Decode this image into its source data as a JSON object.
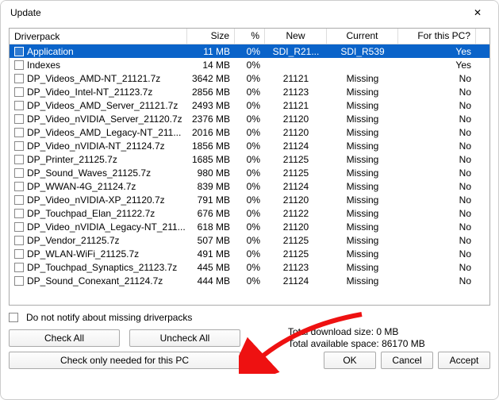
{
  "window": {
    "title": "Update",
    "close_glyph": "✕"
  },
  "columns": {
    "driverpack": "Driverpack",
    "size": "Size",
    "percent": "%",
    "new": "New",
    "current": "Current",
    "forpc": "For this PC?"
  },
  "rows": [
    {
      "name": "Application",
      "size": "11 MB",
      "pct": "0%",
      "new": "SDI_R21...",
      "cur": "SDI_R539",
      "forpc": "Yes",
      "selected": true
    },
    {
      "name": "Indexes",
      "size": "14 MB",
      "pct": "0%",
      "new": "",
      "cur": "",
      "forpc": "Yes"
    },
    {
      "name": "DP_Videos_AMD-NT_21121.7z",
      "size": "3642 MB",
      "pct": "0%",
      "new": "21121",
      "cur": "Missing",
      "forpc": "No"
    },
    {
      "name": "DP_Video_Intel-NT_21123.7z",
      "size": "2856 MB",
      "pct": "0%",
      "new": "21123",
      "cur": "Missing",
      "forpc": "No"
    },
    {
      "name": "DP_Videos_AMD_Server_21121.7z",
      "size": "2493 MB",
      "pct": "0%",
      "new": "21121",
      "cur": "Missing",
      "forpc": "No"
    },
    {
      "name": "DP_Video_nVIDIA_Server_21120.7z",
      "size": "2376 MB",
      "pct": "0%",
      "new": "21120",
      "cur": "Missing",
      "forpc": "No"
    },
    {
      "name": "DP_Videos_AMD_Legacy-NT_211...",
      "size": "2016 MB",
      "pct": "0%",
      "new": "21120",
      "cur": "Missing",
      "forpc": "No"
    },
    {
      "name": "DP_Video_nVIDIA-NT_21124.7z",
      "size": "1856 MB",
      "pct": "0%",
      "new": "21124",
      "cur": "Missing",
      "forpc": "No"
    },
    {
      "name": "DP_Printer_21125.7z",
      "size": "1685 MB",
      "pct": "0%",
      "new": "21125",
      "cur": "Missing",
      "forpc": "No"
    },
    {
      "name": "DP_Sound_Waves_21125.7z",
      "size": "980 MB",
      "pct": "0%",
      "new": "21125",
      "cur": "Missing",
      "forpc": "No"
    },
    {
      "name": "DP_WWAN-4G_21124.7z",
      "size": "839 MB",
      "pct": "0%",
      "new": "21124",
      "cur": "Missing",
      "forpc": "No"
    },
    {
      "name": "DP_Video_nVIDIA-XP_21120.7z",
      "size": "791 MB",
      "pct": "0%",
      "new": "21120",
      "cur": "Missing",
      "forpc": "No"
    },
    {
      "name": "DP_Touchpad_Elan_21122.7z",
      "size": "676 MB",
      "pct": "0%",
      "new": "21122",
      "cur": "Missing",
      "forpc": "No"
    },
    {
      "name": "DP_Video_nVIDIA_Legacy-NT_211...",
      "size": "618 MB",
      "pct": "0%",
      "new": "21120",
      "cur": "Missing",
      "forpc": "No"
    },
    {
      "name": "DP_Vendor_21125.7z",
      "size": "507 MB",
      "pct": "0%",
      "new": "21125",
      "cur": "Missing",
      "forpc": "No"
    },
    {
      "name": "DP_WLAN-WiFi_21125.7z",
      "size": "491 MB",
      "pct": "0%",
      "new": "21125",
      "cur": "Missing",
      "forpc": "No"
    },
    {
      "name": "DP_Touchpad_Synaptics_21123.7z",
      "size": "445 MB",
      "pct": "0%",
      "new": "21123",
      "cur": "Missing",
      "forpc": "No"
    },
    {
      "name": "DP_Sound_Conexant_21124.7z",
      "size": "444 MB",
      "pct": "0%",
      "new": "21124",
      "cur": "Missing",
      "forpc": "No"
    }
  ],
  "notify_label": "Do not notify about missing driverpacks",
  "stats": {
    "download": "Total download size: 0 MB",
    "space": "Total available space: 86170 MB"
  },
  "buttons": {
    "check_all": "Check All",
    "uncheck_all": "Uncheck All",
    "check_needed": "Check only needed for this PC",
    "ok": "OK",
    "cancel": "Cancel",
    "accept": "Accept"
  }
}
